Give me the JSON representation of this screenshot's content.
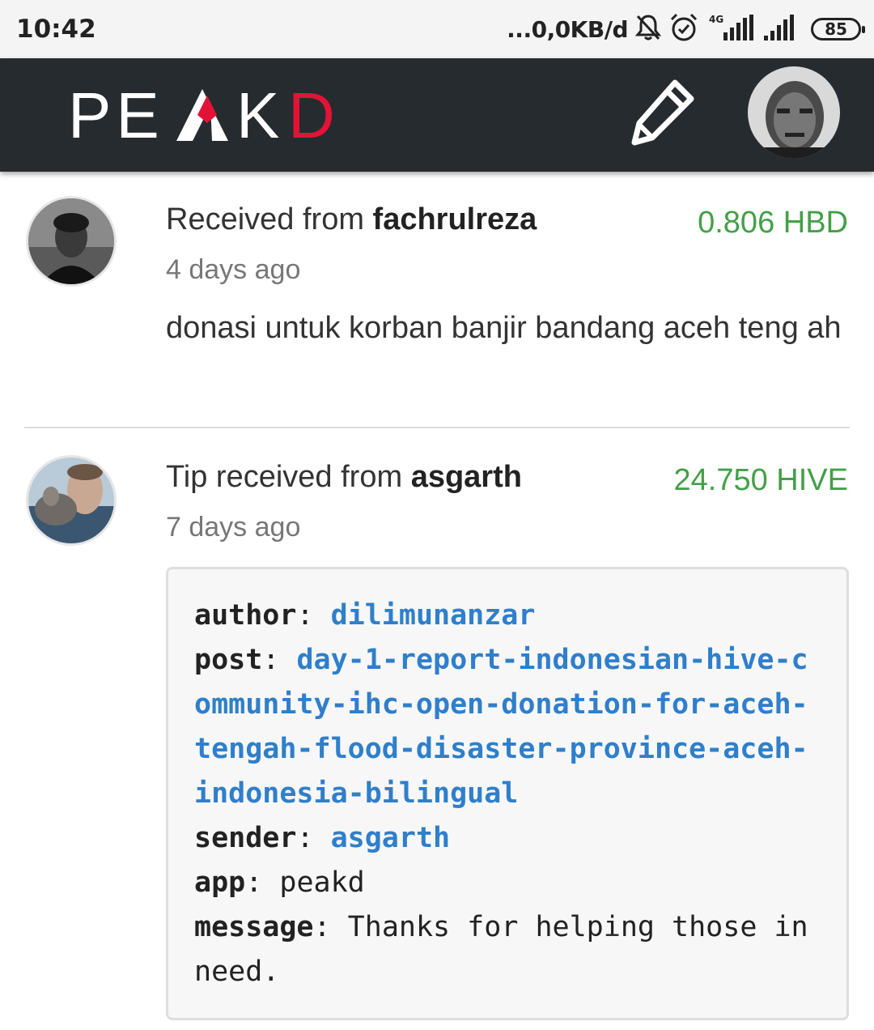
{
  "status_bar": {
    "time": "10:42",
    "speed": "...0,0KB/d",
    "network_type": "4G",
    "battery": "85",
    "icons": [
      "bell-muted-icon",
      "alarm-icon",
      "signal-4g-icon",
      "signal-icon"
    ]
  },
  "header": {
    "logo_prefix": "PE",
    "logo_middle": "A",
    "logo_k": "K",
    "logo_suffix": "D",
    "edit_icon": "pencil-icon",
    "brand_red": "#e31337",
    "bg_color": "#262b2f"
  },
  "activities": [
    {
      "action": "Received from ",
      "user": "fachrulreza",
      "amount": "0.806 HBD",
      "time": "4 days ago",
      "memo": "donasi untuk korban banjir bandang aceh teng ah"
    },
    {
      "action": "Tip received from ",
      "user": "asgarth",
      "amount": "24.750 HIVE",
      "time": "7 days ago",
      "details": {
        "author_key": "author",
        "author_val": "dilimunanzar",
        "post_key": "post",
        "post_val": "day-1-report-indonesian-hive-community-ihc-open-donation-for-aceh-tengah-flood-disaster-province-aceh-indonesia-bilingual",
        "sender_key": "sender",
        "sender_val": "asgarth",
        "app_key": "app",
        "app_val": "peakd",
        "message_key": "message",
        "message_val": "Thanks for helping those in need."
      }
    }
  ],
  "colors": {
    "amount_green": "#43a047",
    "link_blue": "#2f7fcb"
  }
}
